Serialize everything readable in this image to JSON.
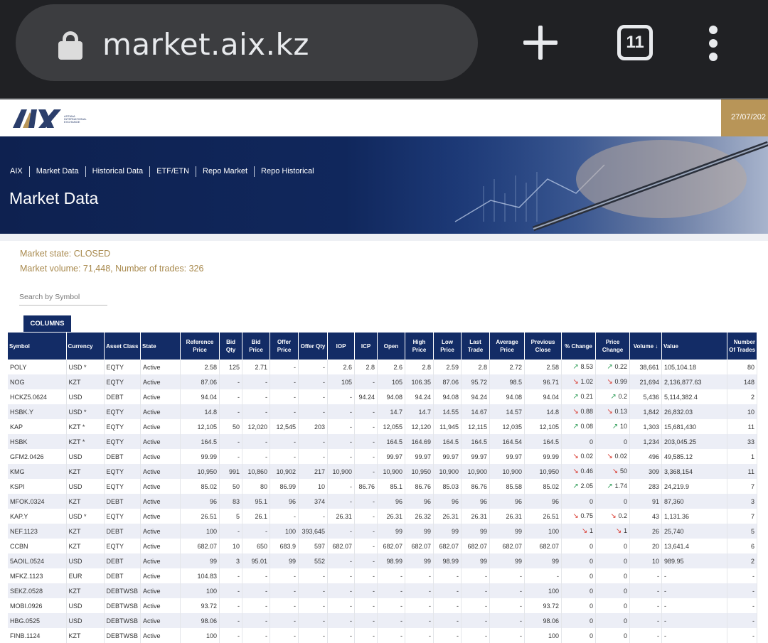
{
  "browser": {
    "url": "market.aix.kz",
    "tab_count": "11"
  },
  "header": {
    "logo_text": "AIX",
    "logo_subtext": "ASTANA INTERNATIONAL EXCHANGE",
    "date": "27/07/202"
  },
  "nav": {
    "items": [
      "AIX",
      "Market Data",
      "Historical Data",
      "ETF/ETN",
      "Repo Market",
      "Repo Historical"
    ]
  },
  "page_title": "Market Data",
  "market": {
    "state": "Market state: CLOSED",
    "volume": "Market volume: 71,448, Number of trades: 326"
  },
  "search": {
    "placeholder": "Search by Symbol"
  },
  "columns_button": "COLUMNS",
  "table": {
    "headers": [
      "Symbol",
      "Currency",
      "Asset Class",
      "State",
      "Reference Price",
      "Bid Qty",
      "Bid Price",
      "Offer Price",
      "Offer Qty",
      "IOP",
      "ICP",
      "Open",
      "High Price",
      "Low Price",
      "Last Trade",
      "Average Price",
      "Previous Close",
      "% Change",
      "Price Change",
      "Volume ↓",
      "Value",
      "Number Of Trades"
    ],
    "rows": [
      [
        "POLY",
        "USD *",
        "EQTY",
        "Active",
        "2.58",
        "125",
        "2.71",
        "-",
        "-",
        "2.6",
        "2.8",
        "2.6",
        "2.8",
        "2.59",
        "2.8",
        "2.72",
        "2.58",
        "up:8.53",
        "up:0.22",
        "38,661",
        "105,104.18",
        "80"
      ],
      [
        "NOG",
        "KZT",
        "EQTY",
        "Active",
        "87.06",
        "-",
        "-",
        "-",
        "-",
        "105",
        "-",
        "105",
        "106.35",
        "87.06",
        "95.72",
        "98.5",
        "96.71",
        "down:1.02",
        "down:0.99",
        "21,694",
        "2,136,877.63",
        "148"
      ],
      [
        "HCKZ5.0624",
        "USD",
        "DEBT",
        "Active",
        "94.04",
        "-",
        "-",
        "-",
        "-",
        "-",
        "94.24",
        "94.08",
        "94.24",
        "94.08",
        "94.24",
        "94.08",
        "94.04",
        "up:0.21",
        "up:0.2",
        "5,436",
        "5,114,382.4",
        "2"
      ],
      [
        "HSBK.Y",
        "USD *",
        "EQTY",
        "Active",
        "14.8",
        "-",
        "-",
        "-",
        "-",
        "-",
        "-",
        "14.7",
        "14.7",
        "14.55",
        "14.67",
        "14.57",
        "14.8",
        "down:0.88",
        "down:0.13",
        "1,842",
        "26,832.03",
        "10"
      ],
      [
        "KAP",
        "KZT *",
        "EQTY",
        "Active",
        "12,105",
        "50",
        "12,020",
        "12,545",
        "203",
        "-",
        "-",
        "12,055",
        "12,120",
        "11,945",
        "12,115",
        "12,035",
        "12,105",
        "up:0.08",
        "up:10",
        "1,303",
        "15,681,430",
        "11"
      ],
      [
        "HSBK",
        "KZT *",
        "EQTY",
        "Active",
        "164.5",
        "-",
        "-",
        "-",
        "-",
        "-",
        "-",
        "164.5",
        "164.69",
        "164.5",
        "164.5",
        "164.54",
        "164.5",
        "0",
        "0",
        "1,234",
        "203,045.25",
        "33"
      ],
      [
        "GFM2.0426",
        "USD",
        "DEBT",
        "Active",
        "99.99",
        "-",
        "-",
        "-",
        "-",
        "-",
        "-",
        "99.97",
        "99.97",
        "99.97",
        "99.97",
        "99.97",
        "99.99",
        "down:0.02",
        "down:0.02",
        "496",
        "49,585.12",
        "1"
      ],
      [
        "KMG",
        "KZT",
        "EQTY",
        "Active",
        "10,950",
        "991",
        "10,860",
        "10,902",
        "217",
        "10,900",
        "-",
        "10,900",
        "10,950",
        "10,900",
        "10,900",
        "10,900",
        "10,950",
        "down:0.46",
        "down:50",
        "309",
        "3,368,154",
        "11"
      ],
      [
        "KSPI",
        "USD",
        "EQTY",
        "Active",
        "85.02",
        "50",
        "80",
        "86.99",
        "10",
        "-",
        "86.76",
        "85.1",
        "86.76",
        "85.03",
        "86.76",
        "85.58",
        "85.02",
        "up:2.05",
        "up:1.74",
        "283",
        "24,219.9",
        "7"
      ],
      [
        "MFOK.0324",
        "KZT",
        "DEBT",
        "Active",
        "96",
        "83",
        "95.1",
        "96",
        "374",
        "-",
        "-",
        "96",
        "96",
        "96",
        "96",
        "96",
        "96",
        "0",
        "0",
        "91",
        "87,360",
        "3"
      ],
      [
        "KAP.Y",
        "USD *",
        "EQTY",
        "Active",
        "26.51",
        "5",
        "26.1",
        "-",
        "-",
        "26.31",
        "-",
        "26.31",
        "26.32",
        "26.31",
        "26.31",
        "26.31",
        "26.51",
        "down:0.75",
        "down:0.2",
        "43",
        "1,131.36",
        "7"
      ],
      [
        "NEF.1123",
        "KZT",
        "DEBT",
        "Active",
        "100",
        "-",
        "-",
        "100",
        "393,645",
        "-",
        "-",
        "99",
        "99",
        "99",
        "99",
        "99",
        "100",
        "down:1",
        "down:1",
        "26",
        "25,740",
        "5"
      ],
      [
        "CCBN",
        "KZT",
        "EQTY",
        "Active",
        "682.07",
        "10",
        "650",
        "683.9",
        "597",
        "682.07",
        "-",
        "682.07",
        "682.07",
        "682.07",
        "682.07",
        "682.07",
        "682.07",
        "0",
        "0",
        "20",
        "13,641.4",
        "6"
      ],
      [
        "5AOIL.0524",
        "USD",
        "DEBT",
        "Active",
        "99",
        "3",
        "95.01",
        "99",
        "552",
        "-",
        "-",
        "98.99",
        "99",
        "98.99",
        "99",
        "99",
        "99",
        "0",
        "0",
        "10",
        "989.95",
        "2"
      ],
      [
        "MFKZ.1123",
        "EUR",
        "DEBT",
        "Active",
        "104.83",
        "-",
        "-",
        "-",
        "-",
        "-",
        "-",
        "-",
        "-",
        "-",
        "-",
        "-",
        "-",
        "0",
        "0",
        "-",
        "-",
        "-"
      ],
      [
        "SEKZ.0528",
        "KZT",
        "DEBTWSB",
        "Active",
        "100",
        "-",
        "-",
        "-",
        "-",
        "-",
        "-",
        "-",
        "-",
        "-",
        "-",
        "-",
        "100",
        "0",
        "0",
        "-",
        "-",
        "-"
      ],
      [
        "MOBI.0926",
        "USD",
        "DEBTWSB",
        "Active",
        "93.72",
        "-",
        "-",
        "-",
        "-",
        "-",
        "-",
        "-",
        "-",
        "-",
        "-",
        "-",
        "93.72",
        "0",
        "0",
        "-",
        "-",
        "-"
      ],
      [
        "HBG.0525",
        "USD",
        "DEBTWSB",
        "Active",
        "98.06",
        "-",
        "-",
        "-",
        "-",
        "-",
        "-",
        "-",
        "-",
        "-",
        "-",
        "-",
        "98.06",
        "0",
        "0",
        "-",
        "-",
        "-"
      ],
      [
        "FINB.1124",
        "KZT",
        "DEBTWSB",
        "Active",
        "100",
        "-",
        "-",
        "-",
        "-",
        "-",
        "-",
        "-",
        "-",
        "-",
        "-",
        "-",
        "100",
        "0",
        "0",
        "-",
        "-",
        "-"
      ]
    ]
  },
  "colors": {
    "navy": "#132c66",
    "gold": "#b89558",
    "up": "#2e9c56",
    "down": "#d9362b"
  }
}
